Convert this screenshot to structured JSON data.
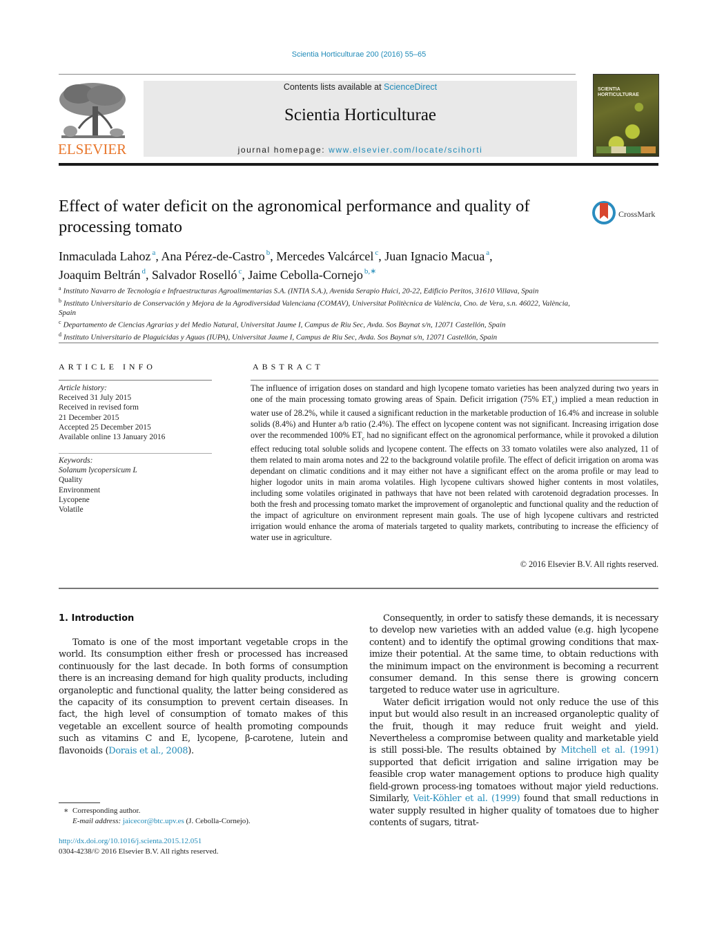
{
  "journal_reference": "Scientia Horticulturae 200 (2016) 55–65",
  "masthead": {
    "publisher_logo_text": "ELSEVIER",
    "contents_prefix": "Contents lists available at ",
    "contents_link": "ScienceDirect",
    "journal_title": "Scientia Horticulturae",
    "homepage_prefix": "journal homepage: ",
    "homepage_link": "www.elsevier.com/locate/scihorti",
    "cover_title_line1": "SCIENTIA",
    "cover_title_line2": "HORTICULTURAE"
  },
  "colors": {
    "link": "#1f8ab8",
    "elsevier_orange": "#e8752a",
    "masthead_bg": "#e9e9e9",
    "crossmark_blue": "#2a8cbf",
    "crossmark_red": "#d8452e"
  },
  "article": {
    "title": "Effect of water deficit on the agronomical performance and quality of processing tomato",
    "crossmark_label": "CrossMark",
    "authors": [
      {
        "name": "Inmaculada Lahoz",
        "sup": "a"
      },
      {
        "name": "Ana Pérez-de-Castro",
        "sup": "b"
      },
      {
        "name": "Mercedes Valcárcel",
        "sup": "c"
      },
      {
        "name": "Juan Ignacio Macua",
        "sup": "a"
      },
      {
        "name": "Joaquim Beltrán",
        "sup": "d"
      },
      {
        "name": "Salvador Roselló",
        "sup": "c"
      },
      {
        "name": "Jaime Cebolla-Cornejo",
        "sup": "b,∗"
      }
    ],
    "affiliations": [
      {
        "mark": "a",
        "text": "Instituto Navarro de Tecnología e Infraestructuras Agroalimentarias S.A. (INTIA S.A.), Avenida Serapio Huici, 20-22, Edificio Peritos, 31610 Villava, Spain"
      },
      {
        "mark": "b",
        "text": "Instituto Universitario de Conservación y Mejora de la Agrodiversidad Valenciana (COMAV), Universitat Politècnica de València, Cno. de Vera, s.n. 46022, València, Spain"
      },
      {
        "mark": "c",
        "text": "Departamento de Ciencias Agrarias y del Medio Natural, Universitat Jaume I, Campus de Riu Sec, Avda. Sos Baynat s/n, 12071 Castellón, Spain"
      },
      {
        "mark": "d",
        "text": "Instituto Universitario de Plaguicidas y Aguas (IUPA), Universitat Jaume I, Campus de Riu Sec, Avda. Sos Baynat s/n, 12071 Castellón, Spain"
      }
    ]
  },
  "article_info": {
    "heading": "ARTICLE INFO",
    "history_label": "Article history:",
    "history": [
      "Received 31 July 2015",
      "Received in revised form",
      "21 December 2015",
      "Accepted 25 December 2015",
      "Available online 13 January 2016"
    ],
    "keywords_label": "Keywords:",
    "keywords": [
      "Solanum lycopersicum L",
      "Quality",
      "Environment",
      "Lycopene",
      "Volatile"
    ]
  },
  "abstract": {
    "heading": "ABSTRACT",
    "part1": "The influence of irrigation doses on standard and high lycopene tomato varieties has been analyzed during two years in one of the main processing tomato growing areas of Spain. Deficit irrigation (75% ET",
    "sub1": "c",
    "part2": ") implied a mean reduction in water use of 28.2%, while it caused a significant reduction in the marketable production of 16.4% and increase in soluble solids (8.4%) and Hunter a/b ratio (2.4%). The effect on lycopene content was not significant. Increasing irrigation dose over the recommended 100% ET",
    "sub2": "c",
    "part3": " had no significant effect on the agronomical performance, while it provoked a dilution effect reducing total soluble solids and lycopene content. The effects on 33 tomato volatiles were also analyzed, 11 of them related to main aroma notes and 22 to the background volatile profile. The effect of deficit irrigation on aroma was dependant on climatic conditions and it may either not have a significant effect on the aroma profile or may lead to higher logodor units in main aroma volatiles. High lycopene cultivars showed higher contents in most volatiles, including some volatiles originated in pathways that have not been related with carotenoid degradation processes. In both the fresh and processing tomato market the improvement of organoleptic and functional quality and the reduction of the impact of agriculture on environment represent main goals. The use of high lycopene cultivars and restricted irrigation would enhance the aroma of materials targeted to quality markets, contributing to increase the efficiency of water use in agriculture.",
    "copyright": "© 2016 Elsevier B.V. All rights reserved."
  },
  "introduction": {
    "heading": "1.  Introduction",
    "left_paragraph": {
      "text_before_link": "Tomato is one of the most important vegetable crops in the world. Its consumption either fresh or processed has increased continuously for the last decade. In both forms of consumption there is an increasing demand for high quality products, including organoleptic and functional quality, the latter being considered as the capacity of its consumption to prevent certain diseases. In fact, the high level of consumption of tomato makes of this vegetable an excellent source of health promoting compounds such as vitamins C and E, lycopene, β-carotene, lutein and flavonoids (",
      "link": "Dorais et al., 2008",
      "text_after_link": ")."
    },
    "right_paragraph_1": "Consequently, in order to satisfy these demands, it is necessary to develop new varieties with an added value (e.g. high lycopene content) and to identify the optimal growing conditions that max-imize their potential. At the same time, to obtain reductions with the minimum impact on the environment is becoming a recurrent consumer demand. In this sense there is growing concern targeted to reduce water use in agriculture.",
    "right_paragraph_2": {
      "text1": "Water deficit irrigation would not only reduce the use of this input but would also result in an increased organoleptic quality of the fruit, though it may reduce fruit weight and yield. Nevertheless a compromise between quality and marketable yield is still possi-ble. The results obtained by ",
      "link1": "Mitchell et al. (1991)",
      "text2": " supported that deficit irrigation and saline irrigation may be feasible crop water management options to produce high quality field-grown process-ing tomatoes without major yield reductions. Similarly, ",
      "link2": "Veit-Köhler et al. (1999)",
      "text3": " found that small reductions in water supply resulted in higher quality of tomatoes due to higher contents of sugars, titrat-"
    }
  },
  "footnotes": {
    "star": "∗",
    "corresponding": "Corresponding author.",
    "email_label": "E-mail address:",
    "email": "jaicecor@btc.upv.es",
    "email_owner": "(J. Cebolla-Cornejo).",
    "doi": "http://dx.doi.org/10.1016/j.scienta.2015.12.051",
    "issn_line": "0304-4238/© 2016 Elsevier B.V. All rights reserved."
  }
}
